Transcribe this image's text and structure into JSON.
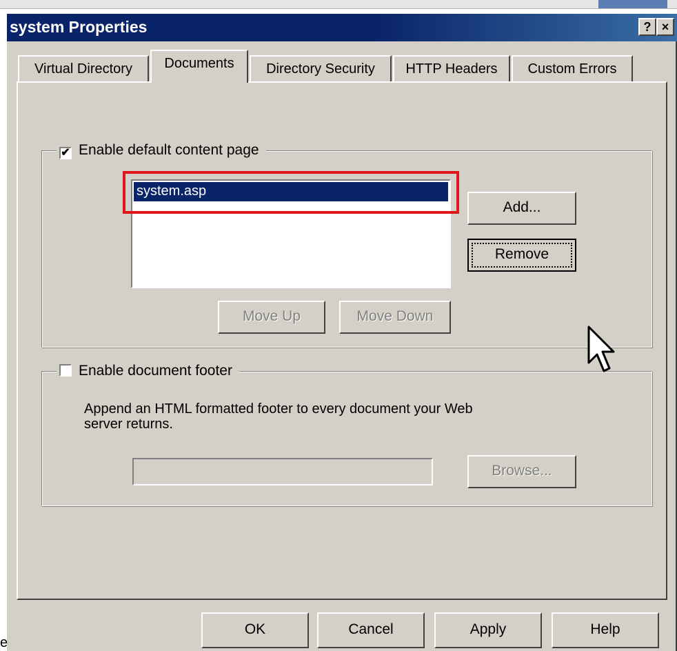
{
  "window": {
    "title": "system Properties",
    "help_btn": "?",
    "close_btn": "×"
  },
  "tabs": [
    {
      "label": "Virtual Directory",
      "active": false
    },
    {
      "label": "Documents",
      "active": true
    },
    {
      "label": "Directory Security",
      "active": false
    },
    {
      "label": "HTTP Headers",
      "active": false
    },
    {
      "label": "Custom Errors",
      "active": false
    }
  ],
  "default_content": {
    "checkbox_label": "Enable default content page",
    "checked": true,
    "check_mark": "✔",
    "documents": [
      "system.asp"
    ],
    "add_label": "Add...",
    "remove_label": "Remove",
    "move_up_label": "Move Up",
    "move_down_label": "Move Down"
  },
  "footer_group": {
    "checkbox_label": "Enable document footer",
    "checked": false,
    "description_line1": "Append an HTML formatted footer to every document your Web",
    "description_line2": "server returns.",
    "path_value": "",
    "browse_label": "Browse..."
  },
  "buttons": {
    "ok": "OK",
    "cancel": "Cancel",
    "apply": "Apply",
    "help": "Help"
  },
  "stray_text": "e",
  "colors": {
    "titlebar": "#0a246a",
    "selection": "#0a246a",
    "highlight_box": "#e0161c",
    "face": "#d4d0c8"
  },
  "icons": {
    "cursor": "arrow-cursor-icon"
  }
}
